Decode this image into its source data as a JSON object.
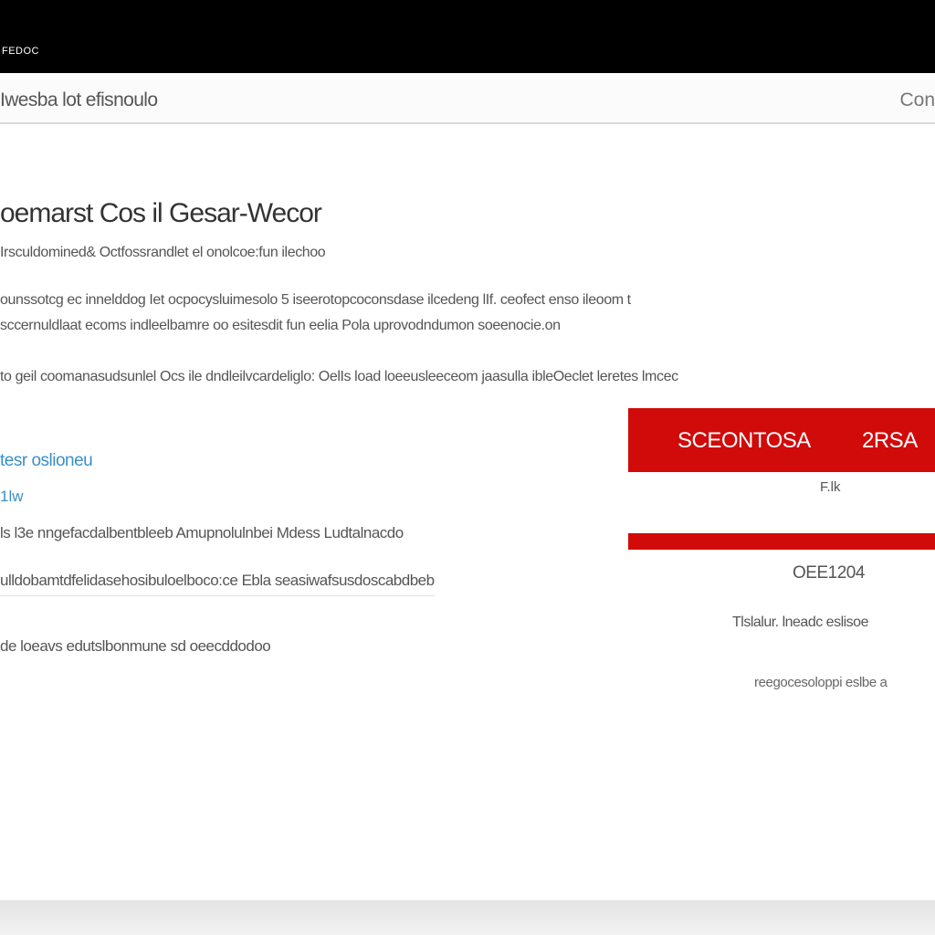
{
  "window": {
    "label": "FEDOC"
  },
  "header": {
    "title": "Iwesba lot efisnoulo",
    "right_label": "Con"
  },
  "main": {
    "title": "oemarst Cos il Gesar-Wecor",
    "subtitle": "Irsculdomined& Octfossrandlet el onolcoe:fun ilechoo",
    "paragraphs": [
      "ounssotcg ec innelddog Iet ocpocysluimesolo 5 iseerotopcoconsdase ilcedeng lIf. ceofect enso ileoom t",
      "sccernuldlaat ecoms indleelbamre oo esitesdit fun eelia Pola uprovodndumon soeenocie.on",
      "to geil coomanasudsunlel Ocs ile dndleilvcardeliglo: OelIs load loeeusleeceom jaasulla ibleOeclet leretes lmcec"
    ],
    "section_link": "tesr oslioneu",
    "section_sublink": "1lw",
    "details": [
      "ls l3e nngefacdalbentbleeb Amupnolulnbei Mdess Ludtalnacdo",
      "ulldobamtdfelidasehosibuloelboco:ce Ebla seasiwafsusdoscabdbeb",
      "de loeavs edutslbonmune sd oeecddodoo"
    ]
  },
  "promo": {
    "button_left": "SCEONTOSA",
    "button_right": "2RSA",
    "small_label": "F.lk",
    "code": "OEE1204",
    "note": "Tlslalur. lneadc eslisoe",
    "footer": "reegocesoloppi eslbe a"
  },
  "colors": {
    "accent_red": "#d10a0a",
    "link_blue": "#3a8fc8",
    "top_bar": "#000000"
  }
}
